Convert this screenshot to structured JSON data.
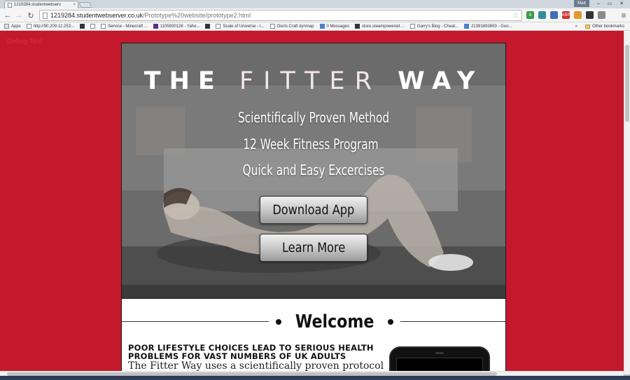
{
  "browser": {
    "tab_title": "1219284.studentwebserv",
    "tab_close": "×",
    "user_name": "Matt",
    "window_controls": {
      "minimize": "–",
      "restore": "▭",
      "close": "✕"
    },
    "nav": {
      "back": "←",
      "forward": "→",
      "reload": "↻"
    },
    "url_host": "1219284.studentwebserver.co.uk",
    "url_path": "/Prototype%20website/prototype2.html",
    "star": "☆",
    "menu": "≡",
    "extensions": [
      {
        "name": "ext-green",
        "color": "#3a9a4a",
        "label": "8"
      },
      {
        "name": "ext-teal",
        "color": "#2f8f9f",
        "label": ""
      },
      {
        "name": "ext-blue",
        "color": "#3f6fb5",
        "label": ""
      },
      {
        "name": "ext-adblock",
        "color": "#d32f2f",
        "label": "ABP"
      },
      {
        "name": "ext-orange",
        "color": "#e49a2a",
        "label": ""
      },
      {
        "name": "ext-dark",
        "color": "#333333",
        "label": ""
      },
      {
        "name": "ext-gray",
        "color": "#8a8a8a",
        "label": ""
      }
    ],
    "bookmarks": [
      {
        "label": "Apps",
        "icon": "apps-grid-icon",
        "style": "g"
      },
      {
        "label": "http://90.209.12.253...",
        "icon": "page-icon",
        "style": ""
      },
      {
        "label": "",
        "icon": "minecraft-icon",
        "style": "dark"
      },
      {
        "label": "",
        "icon": "page-icon",
        "style": ""
      },
      {
        "label": "Service - Minecraft ...",
        "icon": "service-icon",
        "style": ""
      },
      {
        "label": "1105930128 - Yaho...",
        "icon": "yahoo-icon",
        "style": "y"
      },
      {
        "label": "",
        "icon": "folder-icon",
        "style": "dark"
      },
      {
        "label": "Scale of Universe - I...",
        "icon": "page-icon",
        "style": ""
      },
      {
        "label": "Osiris Craft dynmap",
        "icon": "page-icon",
        "style": ""
      },
      {
        "label": "0 Messages",
        "icon": "facebook-icon",
        "style": "blue"
      },
      {
        "label": "store.steampowered....",
        "icon": "steam-icon",
        "style": "dark"
      },
      {
        "label": "Garry's Blog - Cheat...",
        "icon": "blog-icon",
        "style": ""
      },
      {
        "label": "21391693893 - Goo...",
        "icon": "google-icon",
        "style": "blue"
      }
    ],
    "more_bookmarks": "»",
    "other_bookmarks": "Other bookmarks"
  },
  "page": {
    "corner_text": "Debug Text",
    "hero": {
      "title_part1": "THE",
      "title_part2": "FITTER",
      "title_part3": "WAY",
      "taglines": [
        "Scientifically Proven Method",
        "12 Week Fitness Program",
        "Quick and Easy Excercises"
      ],
      "download_button": "Download App",
      "learn_button": "Learn More"
    },
    "welcome": {
      "heading": "Welcome",
      "lede": "POOR LIFESTYLE CHOICES LEAD TO SERIOUS HEALTH PROBLEMS FOR VAST NUMBERS OF UK ADULTS",
      "body": "The Fitter Way uses a scientifically proven protocol that exploits the human body's natural ability to burn fat efficiently"
    }
  },
  "colors": {
    "page_background": "#c4192c",
    "accent": "#e02b3b"
  }
}
